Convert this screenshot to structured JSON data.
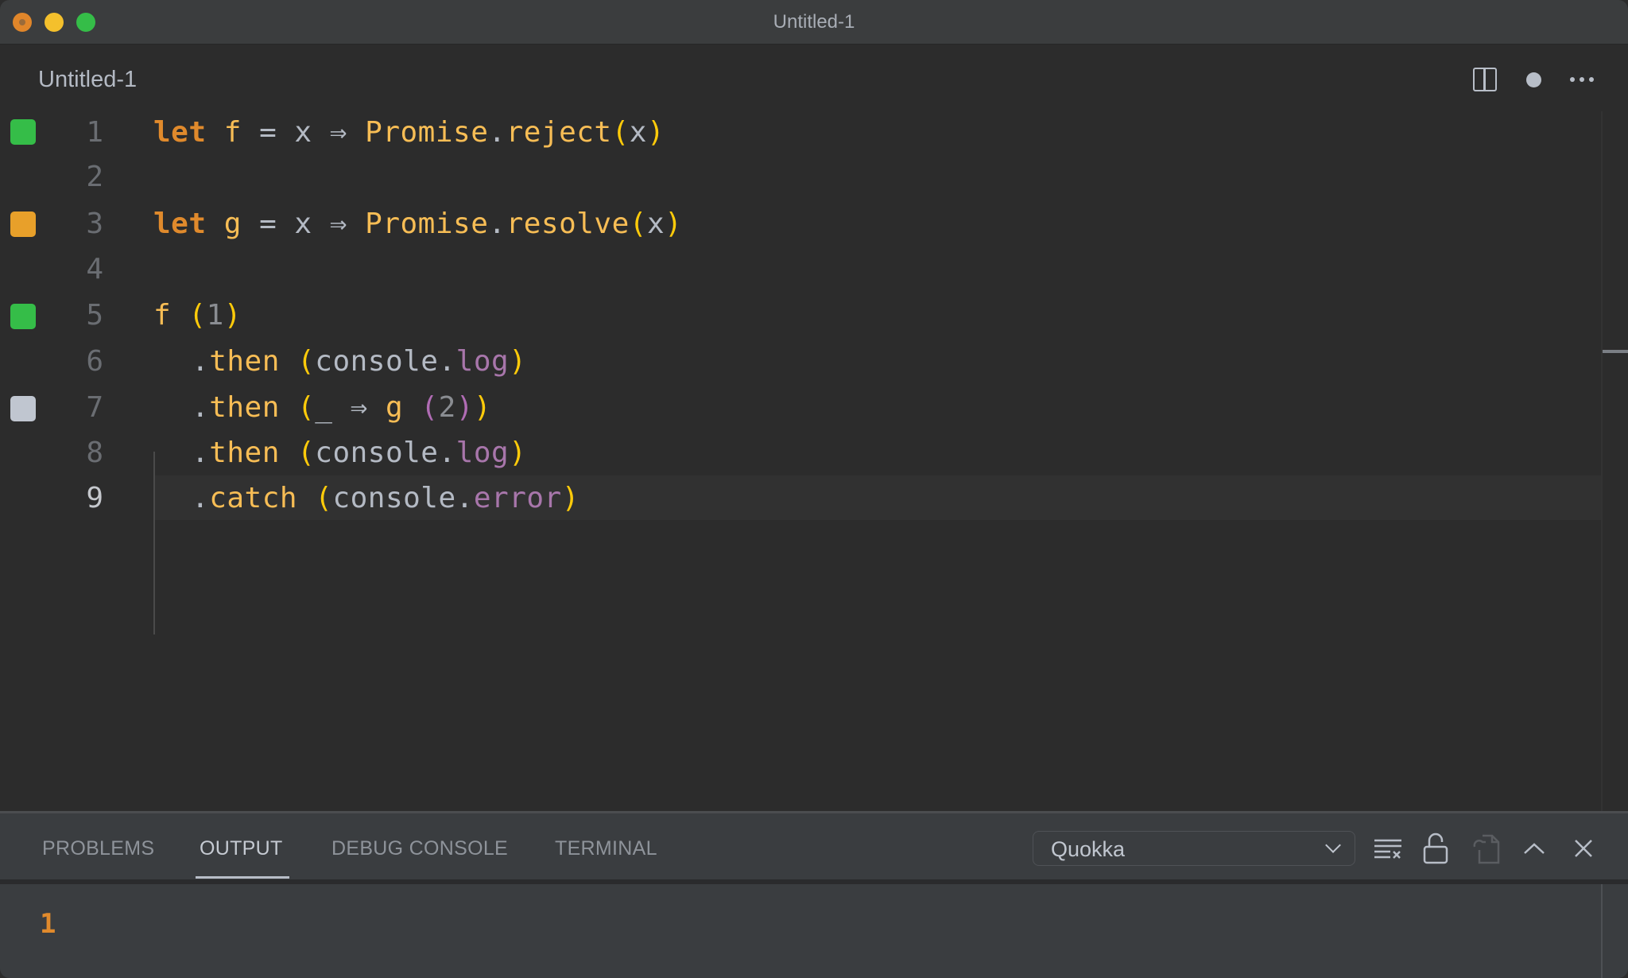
{
  "window": {
    "title": "Untitled-1"
  },
  "editor_tab": {
    "label": "Untitled-1",
    "actions": [
      "split-editor",
      "unsaved-dot",
      "more-actions"
    ]
  },
  "code": {
    "lines": [
      {
        "n": "1",
        "decoration": "green"
      },
      {
        "n": "2",
        "decoration": ""
      },
      {
        "n": "3",
        "decoration": "orange"
      },
      {
        "n": "4",
        "decoration": ""
      },
      {
        "n": "5",
        "decoration": "green"
      },
      {
        "n": "6",
        "decoration": ""
      },
      {
        "n": "7",
        "decoration": "gray"
      },
      {
        "n": "8",
        "decoration": ""
      },
      {
        "n": "9",
        "decoration": ""
      }
    ],
    "tokens": {
      "l1": [
        "let",
        " ",
        "f",
        " = x ",
        "⇒",
        " ",
        "Promise",
        ".",
        "reject",
        "(",
        "x",
        ")"
      ],
      "l3": [
        "let",
        " ",
        "g",
        " = x ",
        "⇒",
        " ",
        "Promise",
        ".",
        "resolve",
        "(",
        "x",
        ")"
      ],
      "l5": [
        "f",
        " ",
        "(",
        "1",
        ")"
      ],
      "l6": [
        ".",
        "then",
        " ",
        "(",
        "console",
        ".",
        "log",
        ")"
      ],
      "l7": [
        ".",
        "then",
        " ",
        "(",
        "_ ",
        "⇒",
        " ",
        "g",
        " ",
        "(",
        "2",
        ")",
        ")"
      ],
      "l8": [
        ".",
        "then",
        " ",
        "(",
        "console",
        ".",
        "log",
        ")"
      ],
      "l9": [
        ".",
        "catch",
        " ",
        "(",
        "console",
        ".",
        "error",
        ")"
      ]
    },
    "current_line": "9"
  },
  "panel": {
    "tabs": [
      {
        "label": "PROBLEMS",
        "active": false
      },
      {
        "label": "OUTPUT",
        "active": true
      },
      {
        "label": "DEBUG CONSOLE",
        "active": false
      },
      {
        "label": "TERMINAL",
        "active": false
      }
    ],
    "channel_select": {
      "value": "Quokka"
    },
    "actions": [
      "clear-output",
      "lock-scroll",
      "open-log-file",
      "maximize-panel",
      "close-panel"
    ],
    "output": [
      "1"
    ]
  },
  "colors": {
    "keyword": "#e08a2c",
    "identifier": "#f7bd55",
    "bracket": "#ffcb0a",
    "bracket_nested": "#b06cb4",
    "property": "#a876ab",
    "decoration_green": "#35bd48",
    "decoration_orange": "#e8a02a",
    "decoration_gray": "#c0c6d0"
  }
}
